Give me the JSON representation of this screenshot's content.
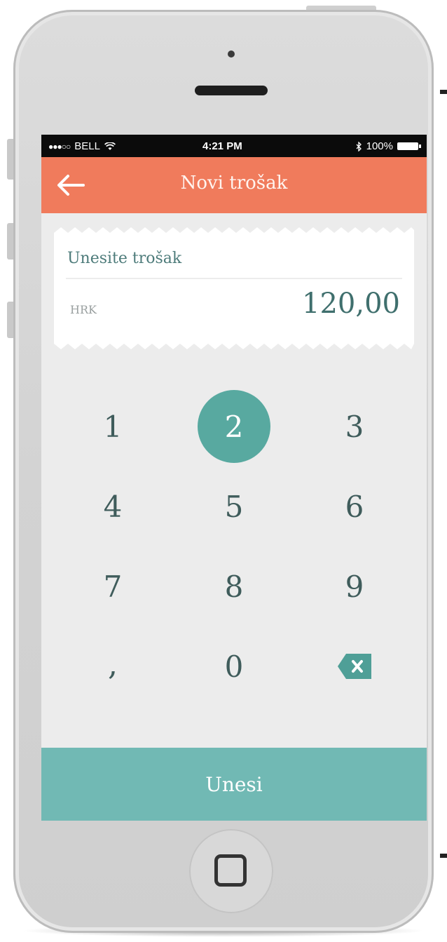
{
  "status_bar": {
    "carrier": "BELL",
    "time": "4:21 PM",
    "battery": "100%"
  },
  "header": {
    "title": "Novi trošak"
  },
  "expense_entry": {
    "prompt": "Unesite trošak",
    "currency": "HRK",
    "amount": "120,00"
  },
  "keypad": {
    "keys": [
      "1",
      "2",
      "3",
      "4",
      "5",
      "6",
      "7",
      "8",
      "9",
      ",",
      "0"
    ],
    "active_key": "2"
  },
  "submit_label": "Unesi",
  "colors": {
    "header": "#f07b5c",
    "accent": "#58a9a0",
    "submit": "#71b9b4",
    "screen_bg": "#ececec"
  },
  "icons": {
    "back": "arrow-left-icon",
    "backspace": "backspace-icon",
    "wifi": "wifi-icon",
    "bluetooth": "bluetooth-icon",
    "battery": "battery-icon",
    "home": "home-button-icon"
  }
}
